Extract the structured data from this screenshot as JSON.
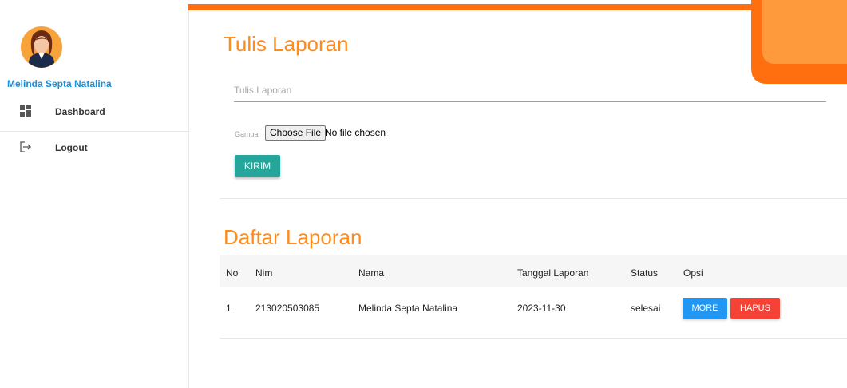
{
  "sidebar": {
    "user_name": "Melinda Septa Natalina",
    "avatar_icon": "user-avatar-icon",
    "items": [
      {
        "label": "Dashboard",
        "icon": "dashboard-icon"
      },
      {
        "label": "Logout",
        "icon": "logout-icon"
      }
    ]
  },
  "form": {
    "title": "Tulis Laporan",
    "input_placeholder": "Tulis Laporan",
    "input_value": "",
    "file_label": "Gambar",
    "file_button": "Choose File",
    "file_status": "No file chosen",
    "submit_label": "KIRIM"
  },
  "list": {
    "title": "Daftar Laporan",
    "columns": [
      "No",
      "Nim",
      "Nama",
      "Tanggal Laporan",
      "Status",
      "Opsi"
    ],
    "rows": [
      {
        "no": "1",
        "nim": "213020503085",
        "nama": "Melinda Septa Natalina",
        "tanggal": "2023-11-30",
        "status": "selesai",
        "more_label": "MORE",
        "hapus_label": "HAPUS"
      }
    ]
  },
  "colors": {
    "accent_orange": "#ff8c1a",
    "topbar_orange": "#ff6f0f",
    "submit_teal": "#26a69a",
    "more_blue": "#2196f3",
    "delete_red": "#f44336",
    "username_blue": "#1d8fd6"
  }
}
